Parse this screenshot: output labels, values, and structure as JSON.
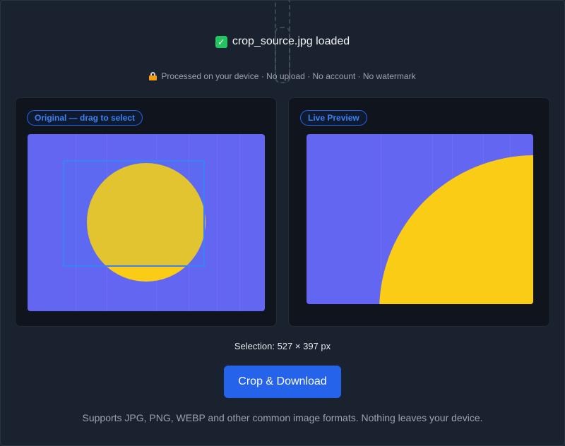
{
  "status": {
    "check_icon": "✓",
    "filename_loaded": "crop_source.jpg loaded"
  },
  "privacy": {
    "text": "Processed on your device · No upload · No account · No watermark"
  },
  "original_panel": {
    "label": "Original — drag to select"
  },
  "preview_panel": {
    "label": "Live Preview"
  },
  "selection": {
    "text": "Selection: 527 × 397 px"
  },
  "actions": {
    "crop_download_label": "Crop & Download"
  },
  "footer": {
    "text": "Supports JPG, PNG, WEBP and other common image formats. Nothing leaves your device."
  },
  "colors": {
    "accent": "#2563eb",
    "canvas_bg": "#6366f1",
    "sun": "#facc15",
    "success": "#22c55e"
  }
}
